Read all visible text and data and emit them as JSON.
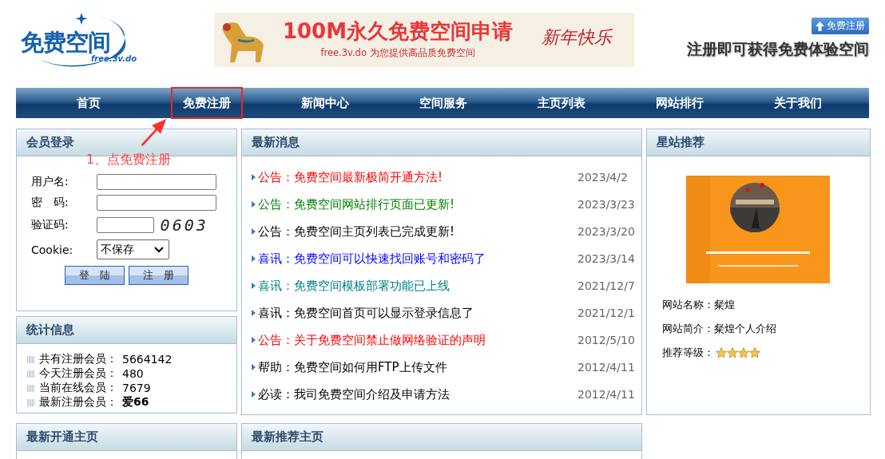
{
  "header": {
    "logo_text": "免费空间",
    "logo_domain": "free.3v.do",
    "banner": {
      "headline": "100M永久免费空间申请",
      "subline": "free.3v.do 为您提供高品质免费空间",
      "greeting": "新年快乐"
    },
    "register_button": "免费注册",
    "slogan": "注册即可获得免费体验空间"
  },
  "nav": [
    {
      "label": "首页",
      "highlighted": false
    },
    {
      "label": "免费注册",
      "highlighted": true
    },
    {
      "label": "新闻中心",
      "highlighted": false
    },
    {
      "label": "空间服务",
      "highlighted": false
    },
    {
      "label": "主页列表",
      "highlighted": false
    },
    {
      "label": "网站排行",
      "highlighted": false
    },
    {
      "label": "关于我们",
      "highlighted": false
    }
  ],
  "annotation": "1、点免费注册",
  "login": {
    "title": "会员登录",
    "username_label": "用户名:",
    "password_label": "密　码:",
    "captcha_label": "验证码:",
    "captcha": "0603",
    "cookie_label": "Cookie:",
    "cookie_value": "不保存",
    "buttons": [
      "登　陆",
      "注　册"
    ]
  },
  "stats": {
    "title": "统计信息",
    "items": [
      {
        "label": "共有注册会员：",
        "value": "5664142",
        "bold": false
      },
      {
        "label": "今天注册会员：",
        "value": "480",
        "bold": false
      },
      {
        "label": "当前在线会员：",
        "value": "7679",
        "bold": false
      },
      {
        "label": "最新注册会员：",
        "value": "爱66",
        "bold": true
      }
    ]
  },
  "news": {
    "title": "最新消息",
    "items": [
      {
        "text": "公告：免费空间最新极简开通方法!",
        "date": "2023/4/2",
        "color": "#ff0000"
      },
      {
        "text": "公告：免费空间网站排行页面已更新!",
        "date": "2023/3/23",
        "color": "#008000"
      },
      {
        "text": "公告：免费空间主页列表已完成更新!",
        "date": "2023/3/20",
        "color": "#000000"
      },
      {
        "text": "喜讯：免费空间可以快速找回账号和密码了",
        "date": "2023/3/14",
        "color": "#0000ff"
      },
      {
        "text": "喜讯：免费空间模板部署功能已上线",
        "date": "2021/12/7",
        "color": "#008080"
      },
      {
        "text": "喜讯：免费空间首页可以显示登录信息了",
        "date": "2021/12/1",
        "color": "#000000"
      },
      {
        "text": "公告：关于免费空间禁止做网络验证的声明",
        "date": "2012/5/10",
        "color": "#ff0000"
      },
      {
        "text": "帮助：免费空间如何用FTP上传文件",
        "date": "2012/4/11",
        "color": "#000000"
      },
      {
        "text": "必读：我司免费空间介绍及申请方法",
        "date": "2012/4/11",
        "color": "#000000"
      }
    ]
  },
  "featured": {
    "title": "星站推荐",
    "name_label": "网站名称：",
    "name": "粲煌",
    "intro_label": "网站简介：",
    "intro": "粲煌个人介绍",
    "rating_label": "推荐等级：",
    "stars": 4
  },
  "bottom": {
    "left_title": "最新开通主页",
    "middle_title": "最新推荐主页"
  }
}
